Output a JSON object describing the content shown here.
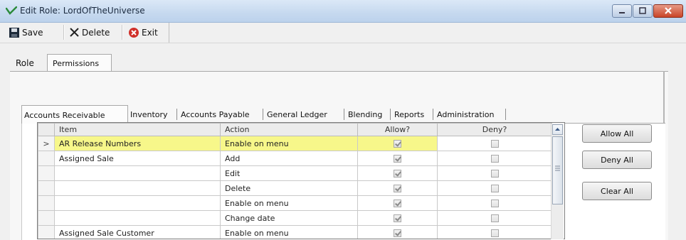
{
  "window": {
    "title": "Edit Role: LordOfTheUniverse",
    "controls": [
      "minimize-icon",
      "maximize-icon",
      "close-icon"
    ]
  },
  "toolbar": {
    "save_label": "Save",
    "delete_label": "Delete",
    "exit_label": "Exit"
  },
  "outer_tabs": [
    {
      "label": "Role",
      "active": false
    },
    {
      "label": "Permissions",
      "active": true
    }
  ],
  "inner_tabs": [
    {
      "label": "Accounts Receivable",
      "active": true
    },
    {
      "label": "Inventory",
      "active": false
    },
    {
      "label": "Accounts Payable",
      "active": false
    },
    {
      "label": "General Ledger",
      "active": false
    },
    {
      "label": "Blending",
      "active": false
    },
    {
      "label": "Reports",
      "active": false
    },
    {
      "label": "Administration",
      "active": false
    }
  ],
  "grid": {
    "columns": [
      "Item",
      "Action",
      "Allow?",
      "Deny?"
    ],
    "rows": [
      {
        "marker": ">",
        "item": "AR Release Numbers",
        "action": "Enable on menu",
        "allow": true,
        "deny": false,
        "highlighted": true
      },
      {
        "marker": "",
        "item": "Assigned Sale",
        "action": "Add",
        "allow": true,
        "deny": false,
        "highlighted": false
      },
      {
        "marker": "",
        "item": "",
        "action": "Edit",
        "allow": true,
        "deny": false,
        "highlighted": false
      },
      {
        "marker": "",
        "item": "",
        "action": "Delete",
        "allow": true,
        "deny": false,
        "highlighted": false
      },
      {
        "marker": "",
        "item": "",
        "action": "Enable on menu",
        "allow": true,
        "deny": false,
        "highlighted": false
      },
      {
        "marker": "",
        "item": "",
        "action": "Change date",
        "allow": true,
        "deny": false,
        "highlighted": false
      },
      {
        "marker": "",
        "item": "Assigned Sale Customer",
        "action": "Enable on menu",
        "allow": true,
        "deny": false,
        "highlighted": false
      }
    ]
  },
  "side_buttons": {
    "allow_all": "Allow All",
    "deny_all": "Deny All",
    "clear_all": "Clear All"
  },
  "colors": {
    "highlight": "#f7f78a",
    "title_bar": "#c6d9ef",
    "close_button": "#c94527"
  }
}
